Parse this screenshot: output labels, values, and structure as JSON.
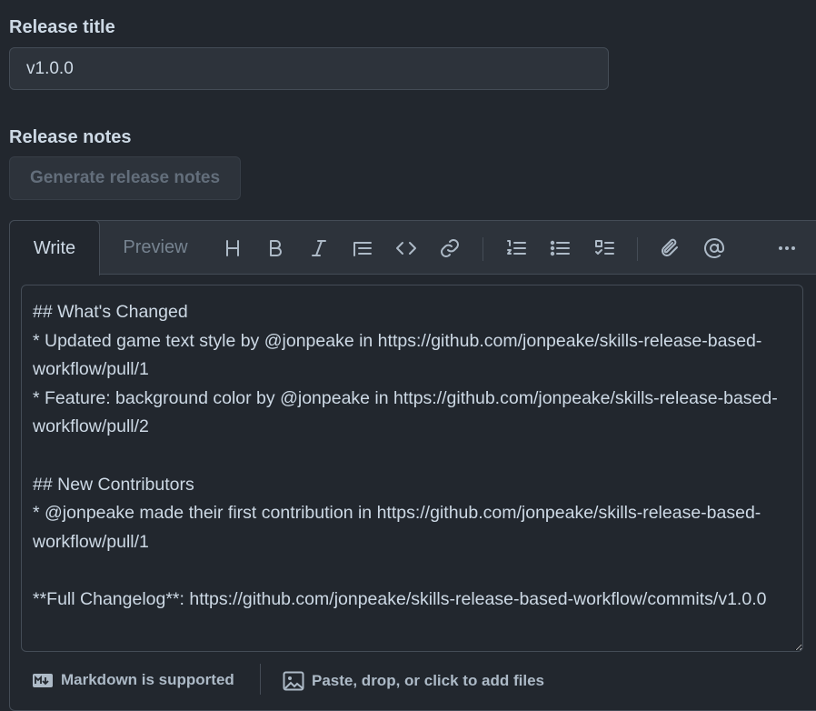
{
  "release_title": {
    "label": "Release title",
    "value": "v1.0.0"
  },
  "release_notes": {
    "label": "Release notes",
    "generate_button": "Generate release notes"
  },
  "editor": {
    "tabs": [
      {
        "label": "Write",
        "active": true
      },
      {
        "label": "Preview",
        "active": false
      }
    ],
    "toolbar": [
      "heading-icon",
      "bold-icon",
      "italic-icon",
      "quote-icon",
      "code-icon",
      "link-icon",
      "ordered-list-icon",
      "unordered-list-icon",
      "task-list-icon",
      "attach-icon",
      "mention-icon",
      "more-icon"
    ],
    "content": "## What's Changed\n* Updated game text style by @jonpeake in https://github.com/jonpeake/skills-release-based-workflow/pull/1\n* Feature: background color by @jonpeake in https://github.com/jonpeake/skills-release-based-workflow/pull/2\n\n## New Contributors\n* @jonpeake made their first contribution in https://github.com/jonpeake/skills-release-based-workflow/pull/1\n\n**Full Changelog**: https://github.com/jonpeake/skills-release-based-workflow/commits/v1.0.0"
  },
  "footer": {
    "markdown_label": "Markdown is supported",
    "attach_label": "Paste, drop, or click to add files"
  },
  "colors": {
    "background": "#22272e",
    "input_background": "#2d333b",
    "border": "#444c56",
    "text": "#cdd9e5",
    "muted": "#768390"
  }
}
